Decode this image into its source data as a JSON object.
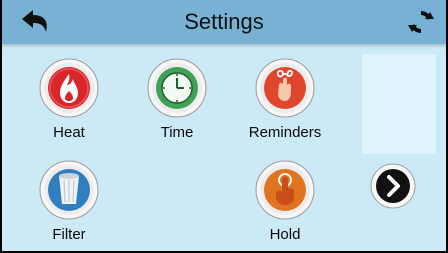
{
  "header": {
    "title": "Settings",
    "back_icon": "back-arrow-icon",
    "refresh_icon": "refresh-icon"
  },
  "tiles": [
    {
      "label": "Heat",
      "icon": "flame-icon",
      "color": "#d8262b"
    },
    {
      "label": "Time",
      "icon": "clock-icon",
      "color": "#3fa357"
    },
    {
      "label": "Reminders",
      "icon": "finger-reminder-icon",
      "color": "#e0452e"
    },
    {
      "label": "Filter",
      "icon": "filter-icon",
      "color": "#2f7fc0"
    },
    {
      "label": "Hold",
      "icon": "hold-hand-icon",
      "color": "#e07420"
    }
  ],
  "navigation": {
    "next_icon": "chevron-right-icon"
  },
  "colors": {
    "header": "#77b2d4",
    "background": "#cce9f6"
  }
}
